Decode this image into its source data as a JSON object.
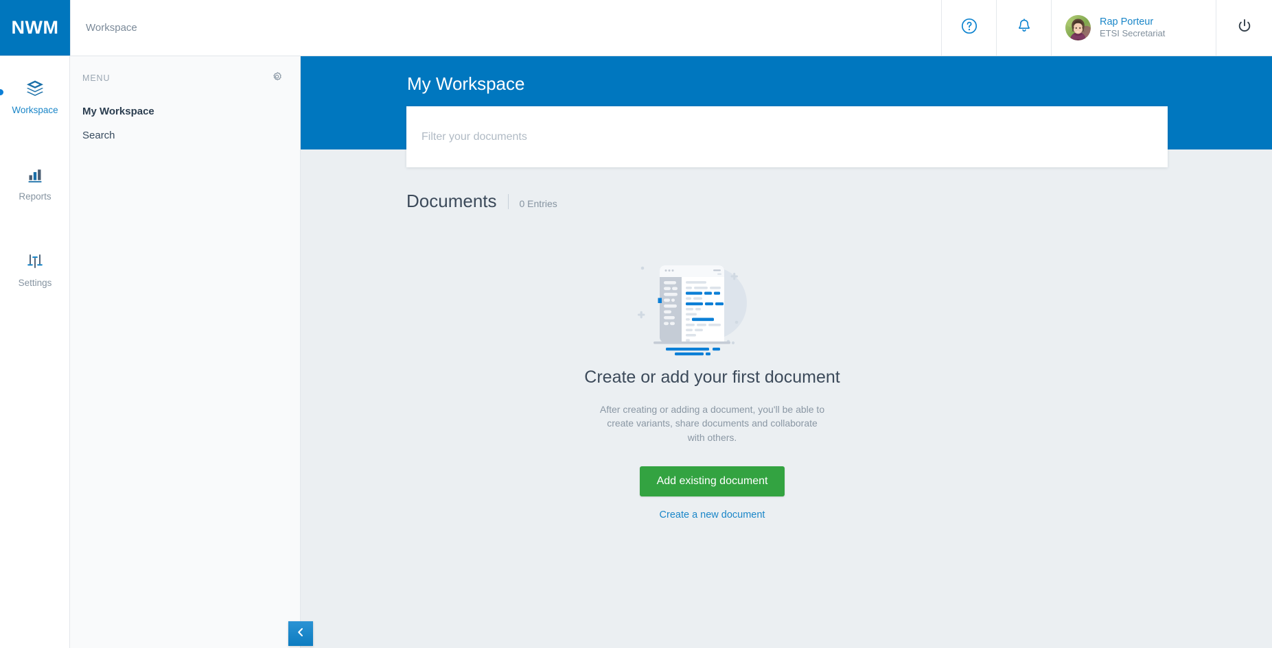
{
  "brand": {
    "name": "NWM"
  },
  "topbar": {
    "breadcrumb": "Workspace",
    "help_icon": "help-circle-icon",
    "notifications_icon": "bell-icon",
    "power_icon": "power-icon",
    "user": {
      "name": "Rap Porteur",
      "role": "ETSI Secretariat",
      "avatar_alt": "user-avatar"
    }
  },
  "rail": {
    "items": [
      {
        "label": "Workspace",
        "icon": "layers-icon",
        "active": true
      },
      {
        "label": "Reports",
        "icon": "bar-chart-icon",
        "active": false
      },
      {
        "label": "Settings",
        "icon": "sliders-icon",
        "active": false
      }
    ]
  },
  "menu": {
    "header": "MENU",
    "settings_icon": "gear-icon",
    "items": [
      {
        "label": "My Workspace",
        "selected": true
      },
      {
        "label": "Search",
        "selected": false
      }
    ],
    "collapse_icon": "chevron-left-icon"
  },
  "main": {
    "title": "My Workspace",
    "filter": {
      "value": "",
      "placeholder": "Filter your documents"
    },
    "documents": {
      "heading": "Documents",
      "count_label": "0 Entries"
    },
    "empty_state": {
      "illustration": "empty-documents-illustration",
      "title": "Create or add your first document",
      "description": "After creating or adding a document, you'll be able to create variants, share documents and collaborate with others.",
      "primary_button": "Add existing document",
      "secondary_link": "Create a new document"
    }
  },
  "colors": {
    "brand_blue": "#0076bd",
    "header_band": "#0077bf",
    "accent_link": "#1a86c8",
    "success_green": "#33a341",
    "page_background": "#ebeff2",
    "panel_background": "#f9fafb"
  }
}
